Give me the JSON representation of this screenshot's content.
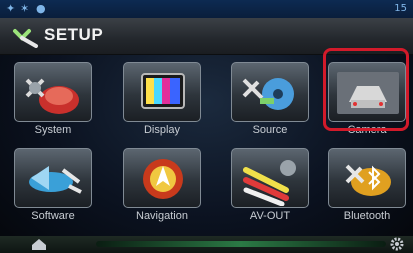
{
  "status": {
    "icons": [
      "gps-icon",
      "settings-dot-icon",
      "record-icon"
    ],
    "time": "15"
  },
  "header": {
    "title": "SETUP"
  },
  "menu": {
    "items": [
      {
        "label": "System",
        "icon": "system-icon"
      },
      {
        "label": "Display",
        "icon": "display-icon"
      },
      {
        "label": "Source",
        "icon": "source-icon"
      },
      {
        "label": "Camera",
        "icon": "camera-icon",
        "selected": true
      },
      {
        "label": "Software",
        "icon": "software-icon"
      },
      {
        "label": "Navigation",
        "icon": "navigation-icon"
      },
      {
        "label": "AV-OUT",
        "icon": "av-out-icon"
      },
      {
        "label": "Bluetooth",
        "icon": "bluetooth-icon"
      }
    ]
  },
  "colors": {
    "highlight": "#d21a2a",
    "title_bar": "#2b2f34",
    "status_bar": "#0d2a52"
  }
}
